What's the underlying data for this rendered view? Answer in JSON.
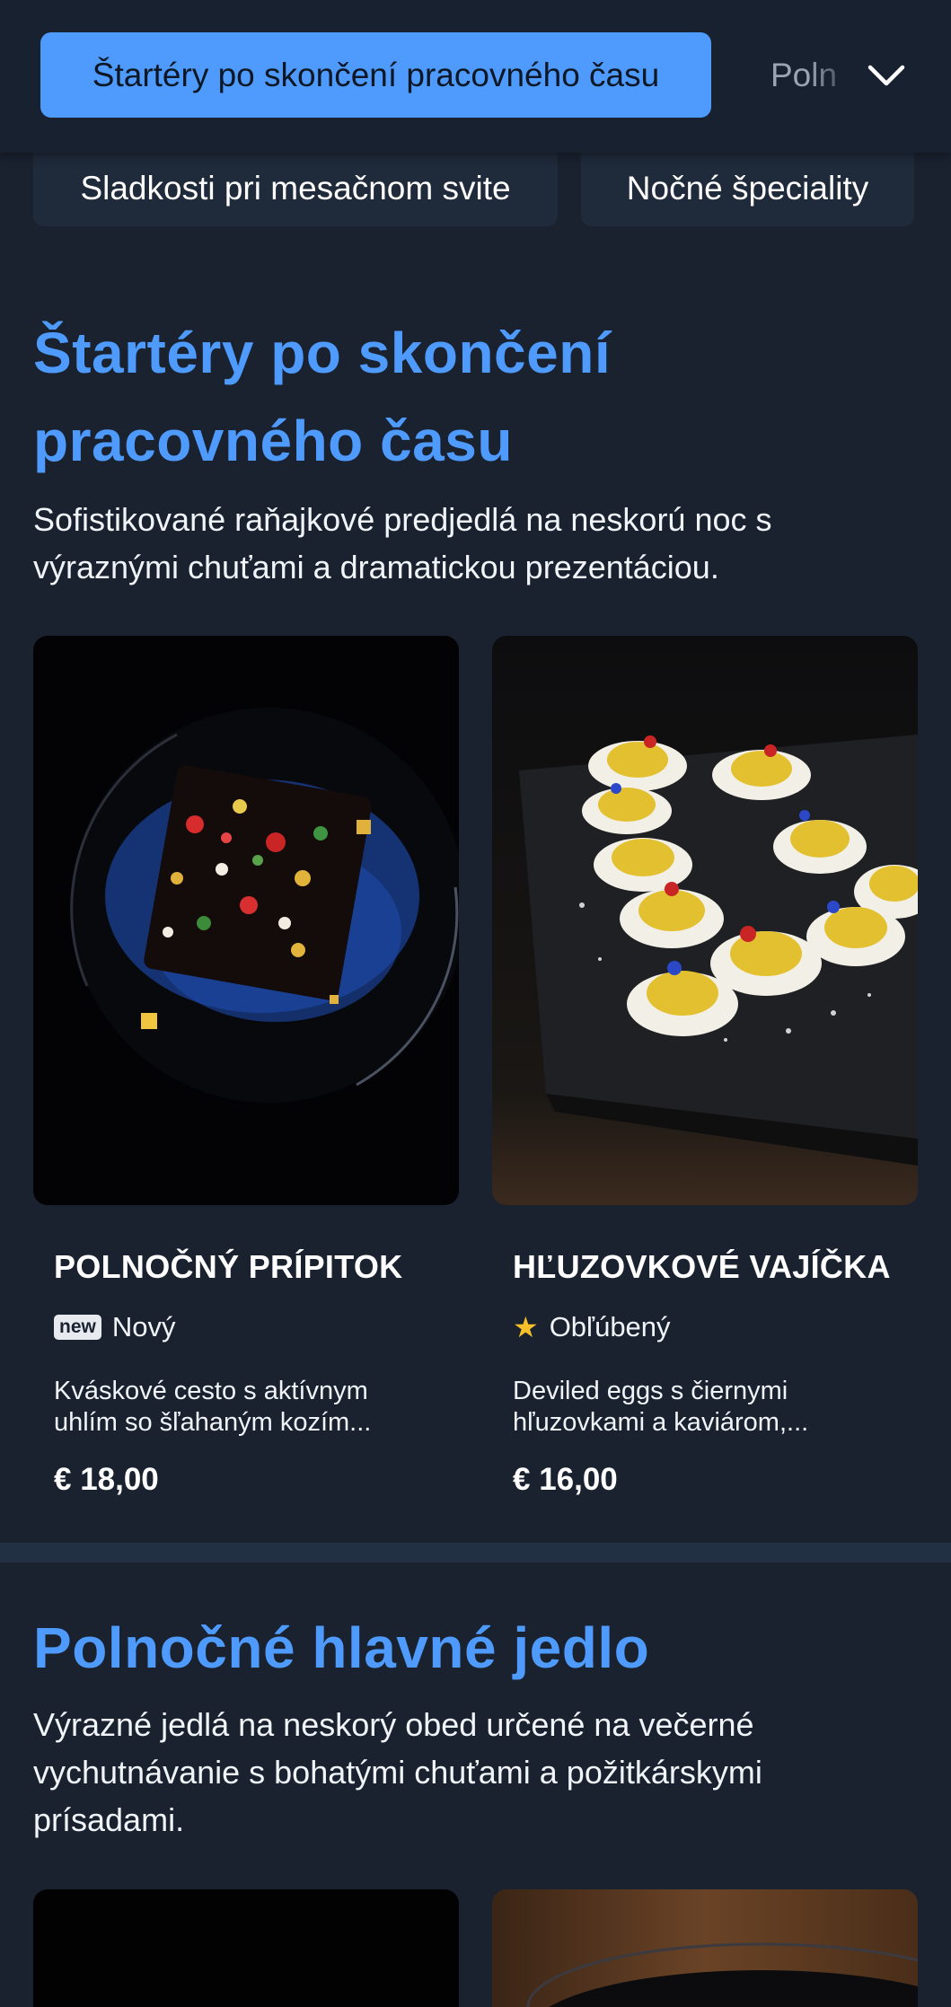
{
  "categories": {
    "active": "Štartéry po skončení pracovného času",
    "peek": "Poln",
    "second_row": [
      "Sladkosti pri mesačnom svite",
      "Nočné špeciality"
    ]
  },
  "section1": {
    "title_line1": "Štartéry po skončení",
    "title_line2": "pracovného času",
    "description": "Sofistikované raňajkové predjedlá na neskorú noc s výraznými chuťami a dramatickou prezentáciou.",
    "items": [
      {
        "name": "POLNOČNÝ PRÍPITOK",
        "badge_icon": "new",
        "badge_label": "Nový",
        "description": "Kváskové cesto s aktívnym uhlím so šľahaným kozím...",
        "price": "€ 18,00"
      },
      {
        "name": "HĽUZOVKOVÉ VAJÍČKA",
        "badge_icon": "star-icon",
        "badge_label": "Obľúbený",
        "description": "Deviled eggs s čiernymi hľuzovkami a kaviárom,...",
        "price": "€ 16,00"
      }
    ]
  },
  "section2": {
    "title": "Polnočné hlavné jedlo",
    "description": "Výrazné jedlá na neskorý obed určené na večerné vychutnávanie s bohatými chuťami a požitkárskymi prísadami."
  },
  "colors": {
    "background": "#1a2230",
    "accent": "#4e9bfd",
    "star": "#f5c02a"
  }
}
